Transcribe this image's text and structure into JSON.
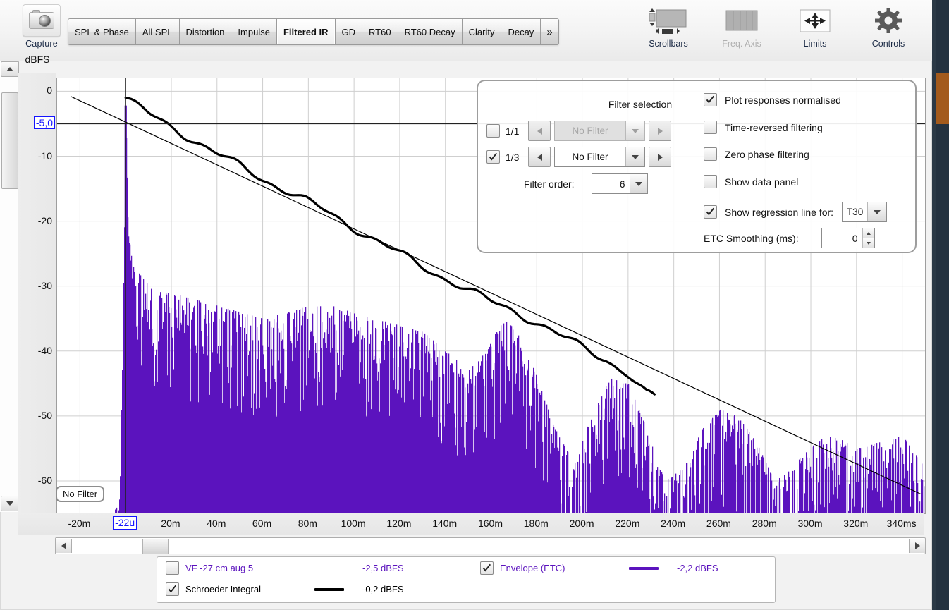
{
  "toolbar": {
    "capture_label": "Capture",
    "capture_icon": "camera-icon",
    "tabs": [
      {
        "label": "SPL & Phase",
        "active": false
      },
      {
        "label": "All SPL",
        "active": false
      },
      {
        "label": "Distortion",
        "active": false
      },
      {
        "label": "Impulse",
        "active": false
      },
      {
        "label": "Filtered IR",
        "active": true
      },
      {
        "label": "GD",
        "active": false
      },
      {
        "label": "RT60",
        "active": false
      },
      {
        "label": "RT60 Decay",
        "active": false
      },
      {
        "label": "Clarity",
        "active": false
      },
      {
        "label": "Decay",
        "active": false
      },
      {
        "label": "»",
        "active": false
      }
    ],
    "tools": [
      {
        "label": "Scrollbars",
        "icon": "scrollbars-icon",
        "disabled": false
      },
      {
        "label": "Freq. Axis",
        "icon": "frequency-axis-icon",
        "disabled": true
      },
      {
        "label": "Limits",
        "icon": "limits-icon",
        "disabled": false
      },
      {
        "label": "Controls",
        "icon": "gear-icon",
        "disabled": false
      }
    ]
  },
  "panel": {
    "filter_selection_title": "Filter selection",
    "octave_1_1_label": "1/1",
    "octave_1_1_checked": false,
    "octave_1_1_value": "No Filter",
    "octave_1_3_label": "1/3",
    "octave_1_3_checked": true,
    "octave_1_3_value": "No Filter",
    "filter_order_label": "Filter order:",
    "filter_order_value": "6",
    "opt_normalised": "Plot responses normalised",
    "opt_normalised_checked": true,
    "opt_time_reversed": "Time-reversed filtering",
    "opt_time_reversed_checked": false,
    "opt_zero_phase": "Zero phase filtering",
    "opt_zero_phase_checked": false,
    "opt_data_panel": "Show data panel",
    "opt_data_panel_checked": false,
    "opt_regression": "Show regression line for:",
    "opt_regression_checked": true,
    "regression_value": "T30",
    "etc_smoothing_label": "ETC Smoothing (ms):",
    "etc_smoothing_value": "0"
  },
  "plot_overlay": {
    "no_filter_chip": "No Filter"
  },
  "legend": {
    "rows": [
      {
        "name": "VF -27 cm aug 5",
        "checked": false,
        "value": "-2,5 dBFS",
        "swatch": "none",
        "color": "#5B13BE"
      },
      {
        "name": "Envelope (ETC)",
        "checked": true,
        "value": "-2,2 dBFS",
        "swatch": "line",
        "color": "#5B13BE"
      },
      {
        "name": "Schroeder Integral",
        "checked": true,
        "value": "-0,2 dBFS",
        "swatch": "line",
        "color": "#000000"
      }
    ]
  },
  "chart_data": {
    "type": "line",
    "title": "Filtered IR",
    "xlabel": "",
    "ylabel": "dBFS",
    "grid": true,
    "xlim": [
      -30,
      350
    ],
    "ylim": [
      -65,
      2
    ],
    "xunit": "ms",
    "x_ticks": [
      "-20m",
      "20m",
      "40m",
      "60m",
      "80m",
      "100m",
      "120m",
      "140m",
      "160m",
      "180m",
      "200m",
      "220m",
      "240m",
      "260m",
      "280m",
      "300m",
      "320m",
      "340ms"
    ],
    "x_tick_values": [
      -20,
      20,
      40,
      60,
      80,
      100,
      120,
      140,
      160,
      180,
      200,
      220,
      240,
      260,
      280,
      300,
      320,
      340
    ],
    "y_ticks": [
      "0",
      "-10",
      "-20",
      "-30",
      "-40",
      "-50",
      "-60"
    ],
    "y_tick_values": [
      0,
      -10,
      -20,
      -30,
      -40,
      -50,
      -60
    ],
    "cursor": {
      "x_label": "-22u",
      "y_label": "-5,0",
      "x_value": -0.022,
      "y_value": -5.0,
      "color": "#1414ff"
    },
    "series": [
      {
        "name": "Envelope (ETC)",
        "color": "#5B13BE",
        "type": "impulse-envelope",
        "peak_dbfs": -2.2,
        "peak_time_ms": 0,
        "noise_floor_dbfs": -62,
        "description": "Purple energy-time curve: peak at 0 ms reaching 0 dBFS, decaying to about -32 dBFS by 30 ms, plateau near -33 dBFS to 130 ms, lobes at 165 ms (-35), 185 ms (-47), 215 ms (-44), 245 ms (-58), 275 ms (-52), 310 ms (-55), 340 ms (-56)",
        "envelope_points": [
          [
            -20,
            -63
          ],
          [
            -3,
            -62
          ],
          [
            -1,
            -30
          ],
          [
            0,
            -2.2
          ],
          [
            1,
            -22
          ],
          [
            3,
            -26
          ],
          [
            6,
            -28
          ],
          [
            10,
            -30
          ],
          [
            16,
            -31
          ],
          [
            22,
            -31
          ],
          [
            30,
            -32
          ],
          [
            40,
            -33
          ],
          [
            50,
            -34
          ],
          [
            60,
            -35
          ],
          [
            70,
            -34
          ],
          [
            80,
            -33
          ],
          [
            90,
            -33
          ],
          [
            100,
            -34
          ],
          [
            110,
            -35
          ],
          [
            120,
            -36
          ],
          [
            130,
            -37
          ],
          [
            140,
            -40
          ],
          [
            150,
            -43
          ],
          [
            158,
            -40
          ],
          [
            165,
            -35
          ],
          [
            172,
            -37
          ],
          [
            180,
            -44
          ],
          [
            188,
            -52
          ],
          [
            196,
            -57
          ],
          [
            204,
            -50
          ],
          [
            212,
            -44
          ],
          [
            220,
            -45
          ],
          [
            228,
            -52
          ],
          [
            236,
            -60
          ],
          [
            244,
            -58
          ],
          [
            252,
            -52
          ],
          [
            260,
            -49
          ],
          [
            268,
            -50
          ],
          [
            276,
            -54
          ],
          [
            284,
            -60
          ],
          [
            292,
            -58
          ],
          [
            300,
            -54
          ],
          [
            310,
            -53
          ],
          [
            320,
            -55
          ],
          [
            330,
            -54
          ],
          [
            340,
            -53
          ],
          [
            348,
            -57
          ]
        ]
      },
      {
        "name": "Schroeder Integral",
        "color": "#000000",
        "type": "line",
        "value_dbfs": -0.2,
        "description": "Black decay curve starting at -1 dBFS at 0 ms, falling nearly linearly to -47 dBFS at 232 ms where it terminates",
        "points": [
          [
            0,
            -1.0
          ],
          [
            10,
            -3.5
          ],
          [
            20,
            -5.5
          ],
          [
            30,
            -7.5
          ],
          [
            40,
            -9.6
          ],
          [
            50,
            -11.5
          ],
          [
            60,
            -13.5
          ],
          [
            70,
            -15.2
          ],
          [
            80,
            -17.0
          ],
          [
            90,
            -19.0
          ],
          [
            100,
            -21.0
          ],
          [
            110,
            -23.0
          ],
          [
            120,
            -25.0
          ],
          [
            130,
            -27.0
          ],
          [
            140,
            -28.8
          ],
          [
            150,
            -30.6
          ],
          [
            160,
            -32.4
          ],
          [
            170,
            -33.8
          ],
          [
            180,
            -35.6
          ],
          [
            190,
            -37.6
          ],
          [
            200,
            -39.4
          ],
          [
            210,
            -41.2
          ],
          [
            220,
            -43.6
          ],
          [
            228,
            -46.6
          ],
          [
            232,
            -47.2
          ]
        ]
      },
      {
        "name": "T30 regression line",
        "color": "#000000",
        "type": "regression",
        "description": "Thin straight regression line from -0.8 dBFS at -24 ms to -62 dBFS at 348 ms",
        "points": [
          [
            -24,
            -0.8
          ],
          [
            348,
            -62.0
          ]
        ]
      }
    ]
  }
}
